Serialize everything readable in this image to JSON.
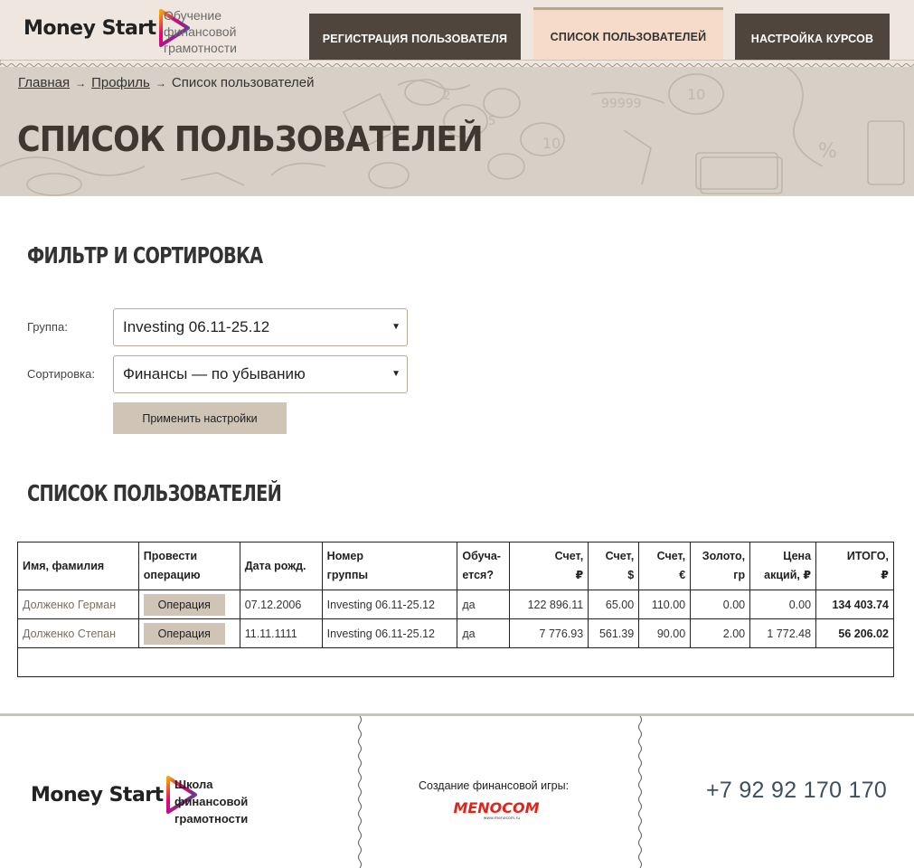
{
  "header": {
    "logo_text": "Money Start",
    "logo_sub": [
      "Обучение",
      "финансовой",
      "грамотности"
    ],
    "nav": [
      {
        "label": "Регистрация пользователя",
        "active": false
      },
      {
        "label": "Список пользователей",
        "active": true
      },
      {
        "label": "Настройка курсов",
        "active": false
      }
    ]
  },
  "breadcrumb": {
    "home": "Главная",
    "profile": "Профиль",
    "current": "Список пользователей",
    "separator": "→"
  },
  "page_title": "СПИСОК ПОЛЬЗОВАТЕЛЕЙ",
  "filter": {
    "title": "ФИЛЬТР И СОРТИРОВКА",
    "group_label": "Группа:",
    "group_value": "Investing 06.11-25.12",
    "sort_label": "Сортировка:",
    "sort_value": "Финансы — по убыванию",
    "apply_label": "Применить настройки"
  },
  "users": {
    "title": "СПИСОК ПОЛЬЗОВАТЕЛЕЙ",
    "headers": {
      "name": "Имя, фамилия",
      "op1": "Провести",
      "op2": "операцию",
      "dob": "Дата рожд.",
      "group1": "Номер",
      "group2": "группы",
      "studies1": "Обуча-",
      "studies2": "ется?",
      "rub1": "Счет,",
      "rub2": "₽",
      "usd1": "Счет,",
      "usd2": "$",
      "eur1": "Счет,",
      "eur2": "€",
      "gold1": "Золото,",
      "gold2": "гр",
      "stock1": "Цена",
      "stock2": "акций, ₽",
      "total1": "ИТОГО,",
      "total2": "₽"
    },
    "rows": [
      {
        "name": "Долженко Герман",
        "op": "Операция",
        "dob": "07.12.2006",
        "group": "Investing 06.11-25.12",
        "studies": "да",
        "rub": "122 896.11",
        "usd": "65.00",
        "eur": "110.00",
        "gold": "0.00",
        "stock": "0.00",
        "total": "134 403.74"
      },
      {
        "name": "Долженко Степан",
        "op": "Операция",
        "dob": "11.11.1111",
        "group": "Investing 06.11-25.12",
        "studies": "да",
        "rub": "7 776.93",
        "usd": "561.39",
        "eur": "90.00",
        "gold": "2.00",
        "stock": "1 772.48",
        "total": "56 206.02"
      }
    ]
  },
  "footer": {
    "logo_text": "Money Start",
    "school": [
      "Школа",
      "финансовой",
      "грамотности"
    ],
    "creator": "Создание финансовой игры:",
    "menocom": "MENOCOM",
    "menocom_url": "www.menocom.ru",
    "phone": "+7 92 92 170 170"
  },
  "colors": {
    "header_bg": "#efe7df",
    "nav_dark": "#4f453c",
    "nav_active": "#f6dcc8",
    "hero_bg": "#d7d0c6",
    "button_bg": "#cfc4b6",
    "menocom_red": "#e2231a",
    "phone": "#3d4f5e"
  }
}
